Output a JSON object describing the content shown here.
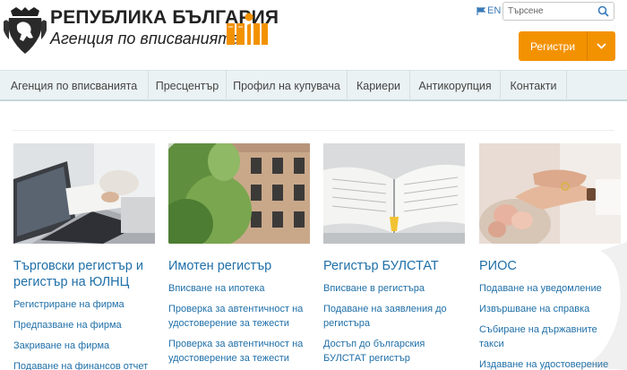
{
  "header": {
    "title_line1": "РЕПУБЛИКА БЪЛГАРИЯ",
    "title_line2": "Агенция по вписванията",
    "lang": "EN",
    "search_placeholder": "Търсене",
    "registers_button": "Регистри"
  },
  "nav": {
    "items": [
      {
        "label": "Агенция по вписванията"
      },
      {
        "label": "Пресцентър"
      },
      {
        "label": "Профил на купувача"
      },
      {
        "label": "Кариери"
      },
      {
        "label": "Антикорупция"
      },
      {
        "label": "Контакти"
      }
    ]
  },
  "cards": [
    {
      "title": "Търговски регистър и регистър на ЮЛНЦ",
      "links": [
        "Регистриране на фирма",
        "Предпазване на фирма",
        "Закриване на фирма",
        "Подаване на финансов отчет"
      ]
    },
    {
      "title": "Имотен регистър",
      "links": [
        "Вписване на ипотека",
        "Проверка за автентичност на удостоверение за тежести",
        "Проверка за автентичност на удостоверение за тежести"
      ]
    },
    {
      "title": "Регистър БУЛСТАТ",
      "links": [
        "Вписване в регистъра",
        "Подаване на заявления до регистъра",
        "Достъп до българския БУЛСТАТ регистър"
      ]
    },
    {
      "title": "РИОС",
      "links": [
        "Подаване на уведомление",
        "Извършване на справка",
        "Събиране на държавните такси",
        "Издаване на удостоверение"
      ]
    }
  ],
  "colors": {
    "accent": "#f39200",
    "link": "#1f6fa8",
    "nav_bg": "#ebf2f3"
  }
}
